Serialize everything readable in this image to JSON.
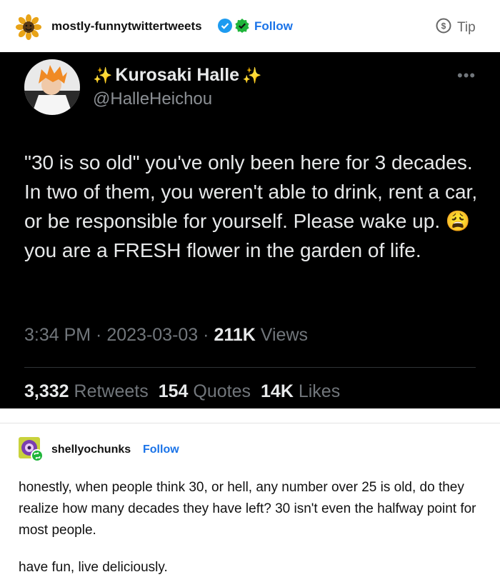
{
  "post": {
    "blog_name": "mostly-funnytwittertweets",
    "follow_label": "Follow",
    "tip_label": "Tip"
  },
  "tweet": {
    "display_name": "Kurosaki Halle",
    "handle": "@HalleHeichou",
    "more_label": "•••",
    "text_before_emoji": "\"30 is so old\" you've only been here for 3 decades. In two of them, you weren't able to drink, rent a car, or be responsible for yourself. Please wake up.",
    "emoji": "😩",
    "text_after_emoji": "you are a FRESH flower in the garden of life.",
    "time": "3:34 PM",
    "date": "2023-03-03",
    "views_count": "211K",
    "views_label": "Views",
    "retweets_count": "3,332",
    "retweets_label": "Retweets",
    "quotes_count": "154",
    "quotes_label": "Quotes",
    "likes_count": "14K",
    "likes_label": "Likes"
  },
  "reblog": {
    "blog_name": "shellyochunks",
    "follow_label": "Follow",
    "paragraph1": "honestly, when people think 30, or hell, any number over 25 is old, do they realize how many decades they have left? 30 isn't even the halfway point for most people.",
    "paragraph2": "have fun, live deliciously."
  },
  "colors": {
    "link_blue": "#1a73e8",
    "tweet_bg": "#000000",
    "verified_blue": "#1d9bf0",
    "verified_green": "#1fb53a"
  },
  "icons": {
    "verified": "verified-badge-icon",
    "tip": "tip-dollar-icon",
    "reblog": "reblog-icon"
  }
}
